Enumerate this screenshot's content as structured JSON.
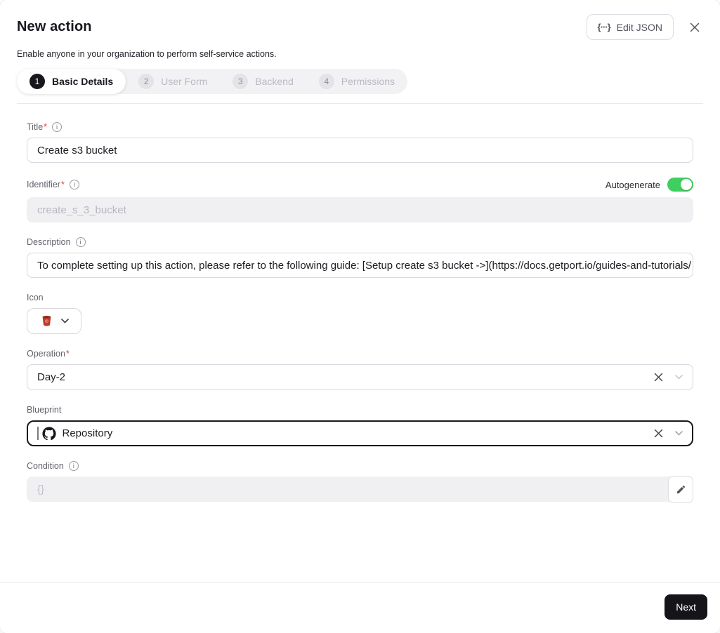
{
  "header": {
    "title": "New action",
    "subtitle": "Enable anyone in your organization to perform self-service actions.",
    "edit_json_label": "Edit JSON"
  },
  "stepper": {
    "steps": [
      {
        "number": "1",
        "label": "Basic Details",
        "state": "active"
      },
      {
        "number": "2",
        "label": "User Form",
        "state": "inactive"
      },
      {
        "number": "3",
        "label": "Backend",
        "state": "inactive"
      },
      {
        "number": "4",
        "label": "Permissions",
        "state": "inactive"
      }
    ]
  },
  "form": {
    "title": {
      "label": "Title",
      "required_mark": "*",
      "value": "Create s3 bucket"
    },
    "identifier": {
      "label": "Identifier",
      "required_mark": "*",
      "value": "create_s_3_bucket",
      "autogenerate_label": "Autogenerate",
      "autogenerate_enabled": true
    },
    "description": {
      "label": "Description",
      "value": "To complete setting up this action, please refer to the following guide: [Setup create s3 bucket ->](https://docs.getport.io/guides-and-tutorials/"
    },
    "icon_field": {
      "label": "Icon",
      "selected_icon": "aws-s3"
    },
    "operation": {
      "label": "Operation",
      "required_mark": "*",
      "value": "Day-2"
    },
    "blueprint": {
      "label": "Blueprint",
      "value": "Repository",
      "value_icon": "github"
    },
    "condition": {
      "label": "Condition",
      "placeholder": "{}"
    }
  },
  "footer": {
    "next_label": "Next"
  },
  "icons": {
    "info_glyph": "i",
    "edit_json_glyph": "{···}"
  },
  "colors": {
    "toggle_on": "#3fcf5f",
    "required": "#ee4338",
    "primary_button": "#141419",
    "focus_border": "#17171d",
    "s3_icon_red": "#c0392b",
    "inactive_step_text": "#b9b9c2"
  }
}
